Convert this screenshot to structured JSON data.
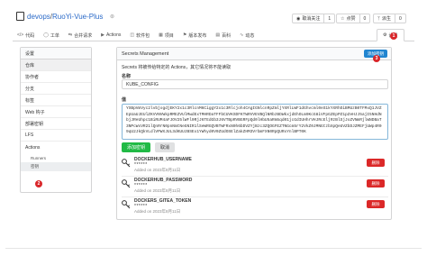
{
  "repo": {
    "owner": "devops",
    "name": "RuoYi-Vue-Plus"
  },
  "actions": {
    "watch_label": "取消关注",
    "watch_count": "1",
    "star_label": "点赞",
    "star_count": "0",
    "fork_label": "派生",
    "fork_count": "0"
  },
  "tabs": [
    {
      "label": "代码",
      "icon": "code-icon"
    },
    {
      "label": "工单",
      "icon": "issue-icon"
    },
    {
      "label": "合并请求",
      "icon": "pull-request-icon"
    },
    {
      "label": "Actions",
      "icon": "actions-icon"
    },
    {
      "label": "软件包",
      "icon": "package-icon"
    },
    {
      "label": "项目",
      "icon": "project-icon"
    },
    {
      "label": "版本发布",
      "icon": "tag-icon"
    },
    {
      "label": "百科",
      "icon": "book-icon"
    },
    {
      "label": "动态",
      "icon": "pulse-icon"
    }
  ],
  "settings_tab": "设置",
  "badges": {
    "one": "1",
    "two": "2",
    "three": "3"
  },
  "sidebar": {
    "header": "设置",
    "items": [
      "仓库",
      "协作者",
      "分支",
      "标签",
      "Web 钩子",
      "部署密钥",
      "LFS",
      "Actions"
    ],
    "subitems": [
      "Runners",
      "密钥"
    ]
  },
  "panel": {
    "title": "Secrets Management",
    "add_button": "添加密钥",
    "description": "Secrets 将被传给特定的 Actions，其它情况将不能读取",
    "name_label": "名称",
    "name_value": "KUBE_CONFIG",
    "value_label": "值",
    "value_text": "YXBpVmVyc2lvbjogdjEKY2x1c3RlcnM6CiggY2x1c3Rlcjoh4CAgIGNlcnRpZmljYXRlLWF1dGhvcml0eS1kYXRhOiBMUzB0TFMxQ1JVZEpUaUJEUlZKVVNVWkpRMEZVUlMwdExTMHRDaTFFbCUVKSDFKTWRVVEVBQlNRbzBDWkxjdEhOLm9KcG8iVFpGZEpPZ1pZeHJJ5ajI5NHdNbjJReUhpc1BiRUM4aFJOV25lWFl0RjJ6TEdGb3J6VTBpRVBGRFpQd0lHbU5aRm5qd01jcGdIUHhrVHJRcEljRzBlSjJoZVNmRjlWNDBaT3NPcWxVR21lQnRrN0pnNmtNeGNIR1lSeWRGQVBTWFRxN0h6bDVZYjBzc3ZQOGFEZTNGcm5rY2VkZ0JMNGtzbXpQeUVZbDJZMEFjUWp4R09qU2JkQkVLdlVPWXJUL3dKUUJBSEx1YWhyd0V0ZUdOSElZakZHM3VrbmFXN0RpQURxYnlBPT0K",
    "add_secret_button": "添加密钥",
    "cancel_button": "取消",
    "secrets": [
      {
        "name": "DOCKERHUB_USERNAME",
        "value": "******",
        "date": "Added on 2023年8月11日"
      },
      {
        "name": "DOCKERHUB_PASSWORD",
        "value": "******",
        "date": "Added on 2023年8月11日"
      },
      {
        "name": "DOCKERS_GITEA_TOKEN",
        "value": "******",
        "date": "Added on 2023年8月11日"
      }
    ],
    "delete_label": "删除"
  },
  "colors": {
    "primary": "#2185d0",
    "success": "#21ba45",
    "danger": "#db2828",
    "badge": "#d9262a",
    "link": "#2b6ac8"
  }
}
